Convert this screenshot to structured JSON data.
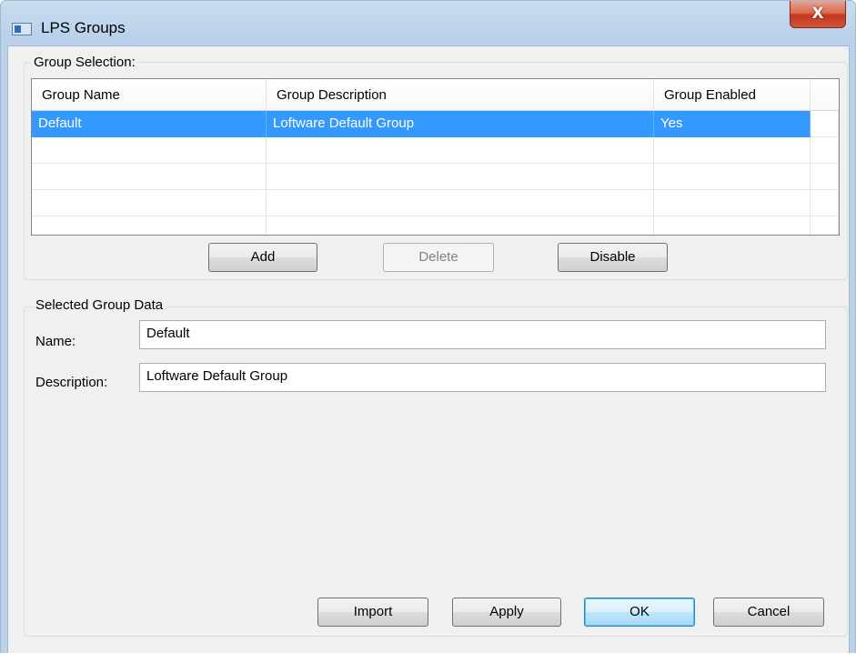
{
  "window": {
    "title": "LPS Groups",
    "close_glyph": "X",
    "icon": "app-window-icon"
  },
  "group_selection": {
    "legend": "Group Selection:",
    "columns": [
      "Group Name",
      "Group Description",
      "Group Enabled"
    ],
    "rows": [
      {
        "name": "Default",
        "description": "Loftware Default Group",
        "enabled": "Yes",
        "selected": true
      },
      {
        "name": "",
        "description": "",
        "enabled": "",
        "selected": false
      },
      {
        "name": "",
        "description": "",
        "enabled": "",
        "selected": false
      },
      {
        "name": "",
        "description": "",
        "enabled": "",
        "selected": false
      }
    ],
    "buttons": {
      "add": "Add",
      "delete": "Delete",
      "disable": "Disable"
    }
  },
  "selected_group_data": {
    "legend": "Selected Group Data",
    "name_label": "Name:",
    "name_value": "Default",
    "description_label": "Description:",
    "description_value": "Loftware Default Group"
  },
  "footer_buttons": {
    "import": "Import",
    "apply": "Apply",
    "ok": "OK",
    "cancel": "Cancel"
  },
  "colors": {
    "selection": "#3399ff",
    "dialog_bg": "#f0f0f0",
    "title_gradient": "#b9d1ea",
    "close_button": "#c1371c"
  }
}
